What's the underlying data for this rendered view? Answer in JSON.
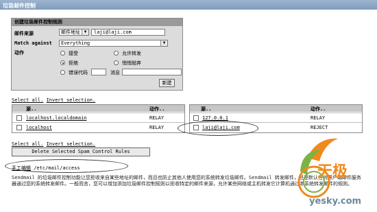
{
  "window": {
    "title": "垃圾邮件控制"
  },
  "rule_panel": {
    "header": "创建垃圾邮件控制规则",
    "source_label": "邮件来源",
    "source_type": "邮件地址",
    "source_value": "laji@laji.com",
    "match_label": "Match against",
    "match_value": "Everything",
    "action_label": "动作",
    "options": [
      "接受",
      "允许转发",
      "拒绝",
      "悄悄抛弃",
      "错误代码"
    ],
    "selected_option": "拒绝",
    "message_label": "消息",
    "error_code_value": "",
    "message_value": "",
    "create_button": "新建"
  },
  "selection": {
    "select_all": "Select all.",
    "invert": "Invert selection."
  },
  "rules_left": {
    "col_source": "源..",
    "col_action": "动作..",
    "rows": [
      {
        "source": "localhost.localdomain",
        "action": "RELAY"
      },
      {
        "source": "localhost",
        "action": "RELAY"
      }
    ]
  },
  "rules_right": {
    "col_source": "源..",
    "col_action": "动作..",
    "rows": [
      {
        "source": "127.0.0.1",
        "action": "RELAY"
      },
      {
        "source": "laji@laji.com",
        "action": "REJECT"
      }
    ]
  },
  "delete_button": "Delete Selected Spam Control Rules",
  "manual_edit": {
    "label": "手工编辑",
    "path": "/etc/mail/access"
  },
  "description": "Sendmail 的垃圾邮件控制功能让您拒收来自某些地址的邮件，而且也防止其他人使用您的系统转发垃圾邮件。Sendmail 转发邮件，但是默认任何客户端邮件服务器通过您的系统转发邮件。一般而言，您可以增加添加垃圾邮件控制规则以拒收特定的邮件来源，允许某些网络或主机转发它计算机通过本系统转发邮件的规则。",
  "watermark": {
    "brand": "天极",
    "site": "yesky.com"
  },
  "colors": {
    "title_bar": "#7f9cbc",
    "panel_header": "#9a9a9a",
    "logo_orange": "#f08a1c",
    "logo_green": "#7cb342"
  }
}
